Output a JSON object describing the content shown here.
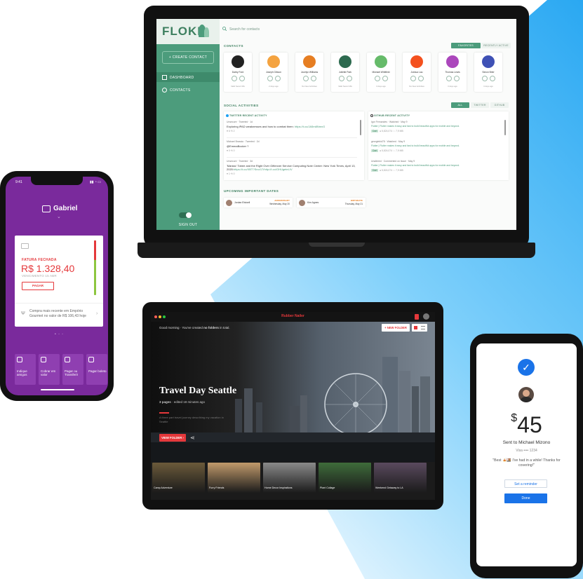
{
  "colors": {
    "flokk_green": "#4c9c7c",
    "nubank_purple": "#7a2a9c",
    "alert_red": "#e5383b",
    "gpay_blue": "#1a73e8"
  },
  "laptop": {
    "logo": "FLOKK",
    "search_placeholder": "Search for contacts",
    "sidebar": {
      "create_contact": "+  CREATE CONTACT",
      "nav": [
        {
          "label": "DASHBOARD",
          "icon": "dashboard-icon"
        },
        {
          "label": "CONTACTS",
          "icon": "person-icon"
        }
      ],
      "sign_out": "SIGN OUT"
    },
    "contacts_title": "CONTACTS",
    "contacts_tabs": [
      "FAVORITES",
      "RECENTLY ACTIVE"
    ],
    "contacts": [
      {
        "name": "Darby Ford",
        "last": "Valid Securl Mix",
        "color": "#222222"
      },
      {
        "name": "Joseph Gibson",
        "last": "2 days ago",
        "color": "#f4a340"
      },
      {
        "name": "Jocelyn Williams",
        "last": "No New Activities",
        "color": "#e67e22"
      },
      {
        "name": "Juliette Park",
        "last": "Valid Securl Mix",
        "color": "#2d6a4f"
      },
      {
        "name": "Michael Whitfield",
        "last": "3 days ago",
        "color": "#66bb6a"
      },
      {
        "name": "Joshua Lau",
        "last": "No New Activities",
        "color": "#f4511e"
      },
      {
        "name": "Thomas Lewis",
        "last": "3 days ago",
        "color": "#ab47bc"
      },
      {
        "name": "Simon Brier",
        "last": "3 days ago",
        "color": "#3f51b5"
      }
    ],
    "social_title": "SOCIAL ACTIVITIES",
    "social_tabs": [
      "ALL",
      "TWITTER",
      "GITHUB"
    ],
    "twitter_title": "TWITTER RECENT ACTIVITY",
    "tweets": [
      {
        "meta": "Unsecure · Tweeted · 1d",
        "text": "Exploring iPAD weaknesses and how to combat them: ",
        "link": "https://t.co/JA5m8NmvG",
        "stats": "♥ 6   ⟲ 2"
      },
      {
        "meta": "Michael Brassia · Tweeted · 2d",
        "text": "@EmmaBocker ?",
        "link": "",
        "stats": "♥ 0   ⟲ 0"
      },
      {
        "meta": "Unsecure · Tweeted · 3d",
        "text": "'Maniac' Tobee and the Right Over Giftenver Service Computing Note Center: New York Times, April 13, 2020:",
        "link": "https://t.co/XBT?Sno/17/http://t.co/GHUgeteLIV",
        "stats": "♥ 1   ⟲ 0"
      }
    ],
    "github_title": "GITHUB RECENT ACTIVITY",
    "commits": [
      {
        "meta": "Igor Fernandes · Watched · May 9",
        "text": "Flutter | Flutter makes it easy and fast to build beautiful apps for mobile and beyond.",
        "tag": "Dart",
        "stats": "● 5,824,074 ☆ 7,9 MB"
      },
      {
        "meta": "georgiebid78 · Watched · May 9",
        "text": "Flutter | Flutter makes it easy and fast to build beautiful apps for mobile and beyond.",
        "tag": "Dart",
        "stats": "● 5,824,074 ☆ 7,9 MB"
      },
      {
        "meta": "Unaltered · Commented on Issue · May 9",
        "text": "Flutter | Flutter makes it easy and fast to build beautiful apps for mobile and beyond.",
        "tag": "Dart",
        "stats": "● 5,824,074 ☆ 7,9 MB"
      }
    ],
    "dates_title": "UPCOMING IMPORTANT DATES",
    "dates": [
      {
        "name": "Jordan Elstoell",
        "type": "ANNIVERSARY",
        "date": "Wednesday, May 20"
      },
      {
        "name": "Kim Agnes",
        "type": "BIRTHDATE",
        "date": "Thursday, May 21"
      }
    ]
  },
  "phone_left": {
    "time": "9:41",
    "user": "Gabriel",
    "bill_label": "FATURA FECHADA",
    "amount": "R$ 1.328,40",
    "due": "VENCIMENTO 15 ABR",
    "pay_button": "PAGAR",
    "purchase_note": "Compra mais recente em Empório Gourmet no valor de R$ 106,43 hoje",
    "tiles": [
      "Indique amigos",
      "Cobrar em valor",
      "Pagar ou Transferir",
      "Pagar boleto"
    ]
  },
  "tablet": {
    "app_title": "Rubber Nailer",
    "greeting": "Good morning · You've created ",
    "greeting_bold": "no folders",
    "greeting_end": " in total.",
    "new_folder": "+  NEW FOLDER",
    "hero_title": "Travel Day Seattle",
    "hero_pages": "3 pages",
    "hero_edited": "· edited 18 minutes ago",
    "hero_desc": "A three part travel journey describing my vacation in Seattle",
    "view_button": "VIEW FOLDER  ›",
    "thumbnails": [
      {
        "label": "Camp Adventure",
        "color": "#6b5a3a"
      },
      {
        "label": "Furry Friends",
        "color": "#c19a6b"
      },
      {
        "label": "Home Decor Inspirations",
        "color": "#8a8a8a"
      },
      {
        "label": "Plant Collage",
        "color": "#3e6b3a"
      },
      {
        "label": "Weekend Getaway to LA",
        "color": "#5a4a5e"
      }
    ]
  },
  "phone_right": {
    "amount_symbol": "$",
    "amount": "45",
    "sent_to": "Sent to Michael Mizono",
    "card": "Visa •••• 1234",
    "message": "\"Best 🍝🍱 I've had in a while! Thanks for covering!\"",
    "reminder_button": "Set a reminder",
    "done_button": "Done"
  }
}
